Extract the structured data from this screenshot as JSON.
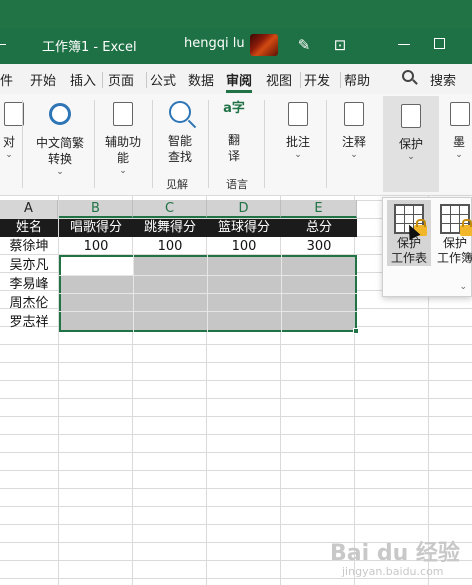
{
  "titlebar": {
    "title": "工作簿1  -  Excel",
    "user": "hengqi lu",
    "icons": [
      "pen-icon",
      "share-icon",
      "minimize-icon",
      "maximize-icon"
    ]
  },
  "menu": {
    "tabs": [
      "件",
      "开始",
      "插入",
      "页面",
      "公式",
      "数据",
      "审阅",
      "视图",
      "开发",
      "帮助"
    ],
    "active": "审阅",
    "search": "搜索"
  },
  "ribbon": {
    "buttons": [
      {
        "id": "accessibility",
        "label": "对",
        "chevron": true
      },
      {
        "id": "chinese",
        "label": "中文简繁\n转换",
        "chevron": true
      },
      {
        "id": "assist",
        "label": "辅助功\n能",
        "chevron": true
      },
      {
        "id": "smart",
        "label": "智能\n查找"
      },
      {
        "id": "translate",
        "label": "翻\n译"
      },
      {
        "id": "comment",
        "label": "批注",
        "chevron": true
      },
      {
        "id": "note",
        "label": "注释",
        "chevron": true
      },
      {
        "id": "protect",
        "label": "保护",
        "chevron": true
      },
      {
        "id": "ink",
        "label": "墨",
        "chevron": true
      }
    ],
    "groups": [
      "见解",
      "语言"
    ]
  },
  "popup": {
    "items": [
      "保护\n工作表",
      "保护\n工作簿"
    ]
  },
  "sheet": {
    "columns": [
      "A",
      "B",
      "C",
      "D",
      "E"
    ],
    "header": [
      "姓名",
      "唱歌得分",
      "跳舞得分",
      "篮球得分",
      "总分"
    ],
    "rows": [
      [
        "蔡徐坤",
        "100",
        "100",
        "100",
        "300"
      ],
      [
        "吴亦凡",
        "",
        "",
        "",
        ""
      ],
      [
        "李易峰",
        "",
        "",
        "",
        ""
      ],
      [
        "周杰伦",
        "",
        "",
        "",
        ""
      ],
      [
        "罗志祥",
        "",
        "",
        "",
        ""
      ]
    ]
  },
  "watermark": {
    "brand": "Bai du 经验",
    "url": "jingyan.baidu.com"
  },
  "colors": {
    "excel_green": "#217346",
    "selection_fill": "#c6c6c6",
    "header_row": "#1b1b1b"
  }
}
